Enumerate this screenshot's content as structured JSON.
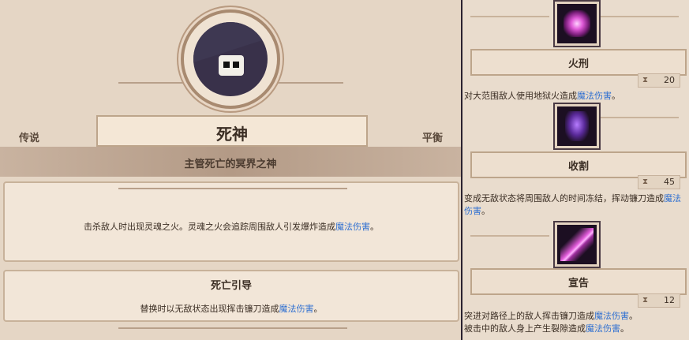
{
  "hero": {
    "name": "死神",
    "rarity": "传说",
    "type": "平衡",
    "subtitle": "主管死亡的冥界之神"
  },
  "passive": {
    "text_plain": "击杀敌人时出现灵魂之火。灵魂之火会追踪周围敌人引发爆炸造成",
    "text_magic": "魔法伤害",
    "text_end": "。"
  },
  "swap": {
    "title": "死亡引导",
    "text_plain": "替换时以无敌状态出现挥击镰刀造成",
    "text_magic": "魔法伤害",
    "text_end": "。"
  },
  "skills": [
    {
      "name": "火刑",
      "cooldown": "20",
      "desc_plain": "对大范围敌人使用地狱火造成",
      "desc_magic": "魔法伤害",
      "desc_end": "。"
    },
    {
      "name": "收割",
      "cooldown": "45",
      "desc_plain": "变成无敌状态将周围敌人的时间冻结，挥动镰刀造成",
      "desc_magic": "魔法伤害",
      "desc_end": "。"
    },
    {
      "name": "宣告",
      "cooldown": "12",
      "desc_plain": "突进对路径上的敌人挥击镰刀造成",
      "desc_magic": "魔法伤害",
      "desc_end": "。",
      "desc2_plain": "被击中的敌人身上产生裂隙造成",
      "desc2_magic": "魔法伤害",
      "desc2_end": "。"
    }
  ],
  "colors": {
    "magic_damage": "#2e6fd1",
    "background": "#e5d6c5"
  }
}
